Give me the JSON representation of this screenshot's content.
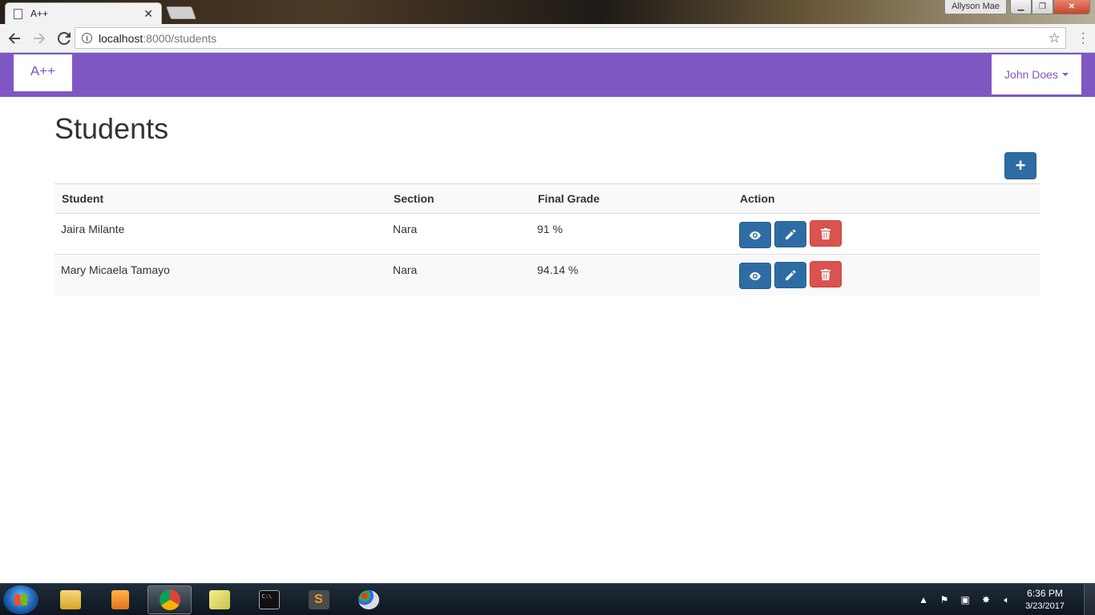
{
  "browser": {
    "tab_title": "A++",
    "tab_close": "✕",
    "window_user": "Allyson Mae",
    "url_host": "localhost",
    "url_rest": ":8000/students"
  },
  "navbar": {
    "brand": "A++",
    "user_name": "John Does"
  },
  "page": {
    "title": "Students",
    "add_label": "+"
  },
  "table": {
    "headers": {
      "student": "Student",
      "section": "Section",
      "grade": "Final Grade",
      "action": "Action"
    },
    "rows": [
      {
        "student": "Jaira Milante",
        "section": "Nara",
        "grade": "91 %"
      },
      {
        "student": "Mary Micaela Tamayo",
        "section": "Nara",
        "grade": "94.14 %"
      }
    ]
  },
  "taskbar": {
    "apps": [
      "file-explorer",
      "media-player",
      "chrome",
      "sticky-notes",
      "command-prompt",
      "sublime-text",
      "paint"
    ],
    "time": "6:36 PM",
    "date": "3/23/2017"
  },
  "colors": {
    "navbar": "#7e57c2",
    "primary": "#2e6da4",
    "danger": "#d9534f"
  }
}
